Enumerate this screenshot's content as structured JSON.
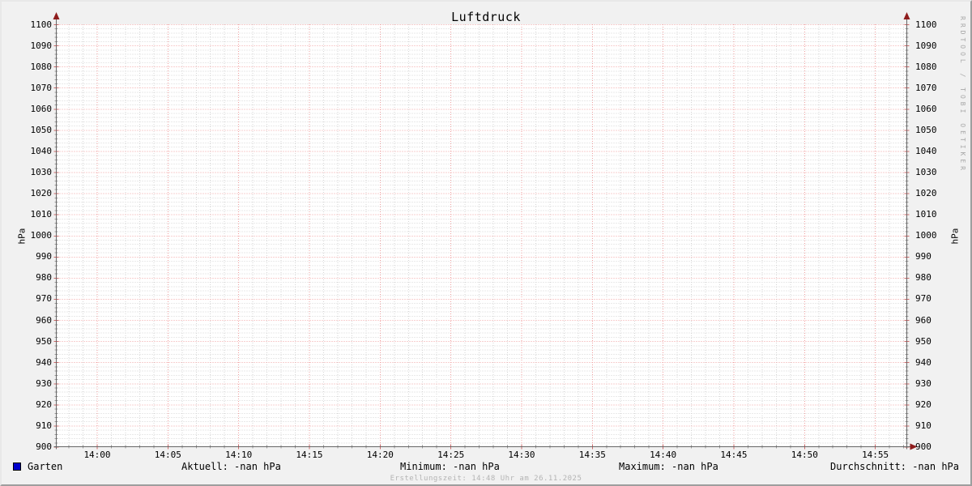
{
  "title": "Luftdruck",
  "watermark": "RRDTOOL / TOBI OETIKER",
  "y_axis": {
    "unit_left": "hPa",
    "unit_right": "hPa"
  },
  "legend": {
    "series_label": "Garten",
    "stats": [
      {
        "text": "Aktuell: -nan hPa"
      },
      {
        "text": "Minimum: -nan hPa"
      },
      {
        "text": "Maximum: -nan hPa"
      },
      {
        "text": "Durchschnitt: -nan hPa"
      }
    ]
  },
  "footer": {
    "creation_text": "Erstellungszeit: 14:48 Uhr am 26.11.2025"
  },
  "colors": {
    "background": "#f1f1f1",
    "canvas": "#ffffff",
    "grid_minor": "#d5d5d5",
    "grid_major": "#f0a0a0",
    "tick_minor": "#9a9a9a",
    "tick_major": "#cc6666",
    "axis": "#666666",
    "arrow": "#8f1d1d",
    "series": "#0000cc",
    "text": "#000000",
    "muted_text": "#b4b4b4",
    "watermark_text": "#a8a8a8"
  },
  "chart_data": {
    "type": "line",
    "title": "Luftdruck",
    "xlabel": "",
    "ylabel": "hPa",
    "ylim": [
      900,
      1100
    ],
    "y_tick_step": 10,
    "y_minor_step": 2,
    "x_ticks": [
      "14:00",
      "14:05",
      "14:10",
      "14:15",
      "14:20",
      "14:25",
      "14:30",
      "14:35",
      "14:40",
      "14:45",
      "14:50",
      "14:55"
    ],
    "x_minor_per_major": 5,
    "grid": "on",
    "legend_position": "bottom",
    "series": [
      {
        "name": "Garten",
        "color": "#0000cc",
        "values": []
      }
    ],
    "stats": {
      "aktuell": "-nan hPa",
      "minimum": "-nan hPa",
      "maximum": "-nan hPa",
      "durchschnitt": "-nan hPa"
    }
  }
}
